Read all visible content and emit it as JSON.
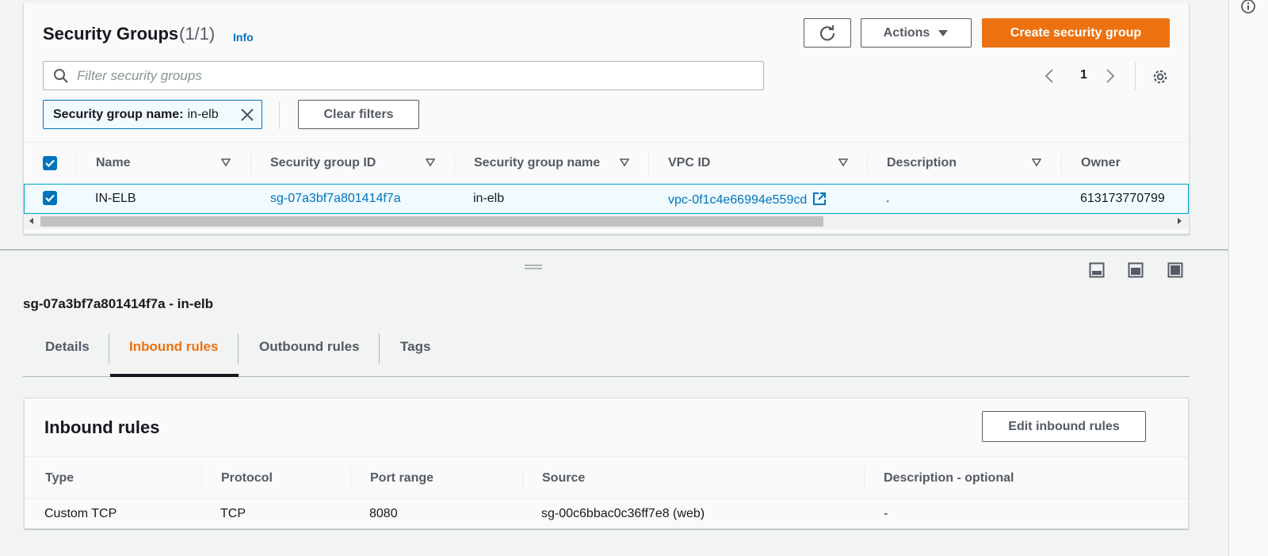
{
  "security_groups": {
    "title": "Security Groups",
    "count": "(1/1)",
    "info_link": "Info",
    "refresh_icon": "refresh-icon",
    "actions_label": "Actions",
    "create_label": "Create security group",
    "search_placeholder": "Filter security groups",
    "search_value": "",
    "pagination": {
      "current_page": "1"
    },
    "filter_token": {
      "key": "Security group name:",
      "value": "in-elb"
    },
    "clear_filters_label": "Clear filters",
    "columns": [
      "Name",
      "Security group ID",
      "Security group name",
      "VPC ID",
      "Description",
      "Owner"
    ],
    "rows": [
      {
        "selected": true,
        "name": "IN-ELB",
        "sg_id": "sg-07a3bf7a801414f7a",
        "sg_name": "in-elb",
        "vpc_id": "vpc-0f1c4e66994e559cd",
        "description": ".",
        "owner": "613173770799"
      }
    ]
  },
  "details": {
    "title": "sg-07a3bf7a801414f7a - in-elb",
    "tabs": [
      {
        "label": "Details",
        "active": false
      },
      {
        "label": "Inbound rules",
        "active": true
      },
      {
        "label": "Outbound rules",
        "active": false
      },
      {
        "label": "Tags",
        "active": false
      }
    ]
  },
  "inbound_rules": {
    "title": "Inbound rules",
    "edit_label": "Edit inbound rules",
    "columns": [
      "Type",
      "Protocol",
      "Port range",
      "Source",
      "Description - optional"
    ],
    "rows": [
      {
        "type": "Custom TCP",
        "protocol": "TCP",
        "port_range": "8080",
        "source": "sg-00c6bbac0c36ff7e8 (web)",
        "description": "-"
      }
    ]
  },
  "colors": {
    "accent_orange": "#ec7211",
    "link_blue": "#0073bb",
    "selected_row_bg": "#f1faff",
    "text_dark": "#16191f",
    "text_muted": "#545b64"
  }
}
